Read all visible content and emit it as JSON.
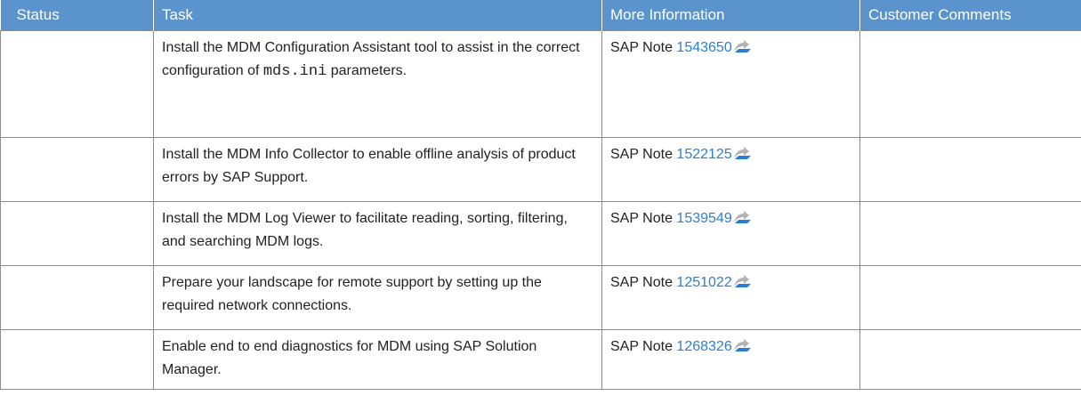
{
  "table": {
    "headers": {
      "status": "Status",
      "task": "Task",
      "more_info": "More Information",
      "comments": "Customer Comments"
    },
    "rows": [
      {
        "status": "",
        "task_before": "Install the MDM Configuration Assistant tool to assist in the correct configuration of ",
        "task_code": "mds.ini",
        "task_after": " parameters.",
        "note_prefix": "SAP Note ",
        "note_number": "1543650",
        "comments": ""
      },
      {
        "status": "",
        "task": "Install the MDM Info Collector to enable offline analysis of product errors by SAP Support.",
        "note_prefix": "SAP Note ",
        "note_number": "1522125",
        "comments": ""
      },
      {
        "status": "",
        "task": "Install the MDM Log Viewer to facilitate reading, sorting, filtering, and searching MDM logs.",
        "note_prefix": "SAP Note ",
        "note_number": "1539549",
        "comments": ""
      },
      {
        "status": "",
        "task": "Prepare your landscape for remote support by setting up the required network connections.",
        "note_prefix": "SAP Note ",
        "note_number": "1251022",
        "comments": ""
      },
      {
        "status": "",
        "task": "Enable end to end diagnostics for MDM using SAP Solution Manager.",
        "note_prefix": "SAP Note ",
        "note_number": "1268326",
        "comments": ""
      }
    ],
    "icons": {
      "external_link": "external-link-icon"
    },
    "colors": {
      "header_bg": "#5b94cc",
      "link": "#2a7fd4",
      "border": "#8c8c8c"
    }
  }
}
